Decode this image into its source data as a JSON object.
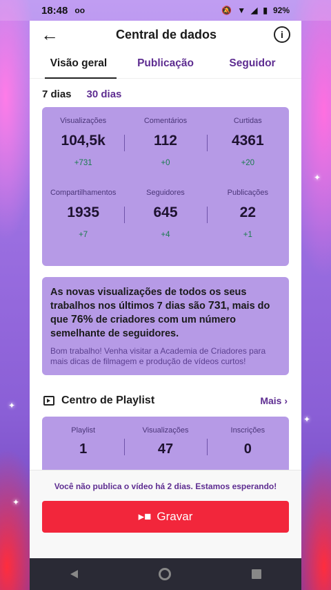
{
  "status": {
    "time": "18:48",
    "voicemail": "oo",
    "battery": "92%"
  },
  "header": {
    "title": "Central de dados"
  },
  "tabs": [
    {
      "label": "Visão geral"
    },
    {
      "label": "Publicação"
    },
    {
      "label": "Seguidor"
    }
  ],
  "period": {
    "selected": "7 dias",
    "other": "30 dias"
  },
  "stats": [
    [
      {
        "label": "Visualizações",
        "value": "104,5k",
        "delta": "+731"
      },
      {
        "label": "Comentários",
        "value": "112",
        "delta": "+0"
      },
      {
        "label": "Curtidas",
        "value": "4361",
        "delta": "+20"
      }
    ],
    [
      {
        "label": "Compartilhamentos",
        "value": "1935",
        "delta": "+7"
      },
      {
        "label": "Seguidores",
        "value": "645",
        "delta": "+4"
      },
      {
        "label": "Publicações",
        "value": "22",
        "delta": "+1"
      }
    ]
  ],
  "message": {
    "pre": "As novas visualizações de todos os seus trabalhos nos últimos 7 dias são ",
    "num1": "731",
    "mid": ", mais do que ",
    "num2": "76%",
    "post": " de criadores com um número semelhante de seguidores.",
    "sub": "Bom trabalho! Venha visitar a Academia de Criadores para mais dicas de filmagem e produção de vídeos curtos!"
  },
  "playlist": {
    "title": "Centro de Playlist",
    "more": "Mais",
    "stats": [
      {
        "label": "Playlist",
        "value": "1"
      },
      {
        "label": "Visualizações",
        "value": "47"
      },
      {
        "label": "Inscrições",
        "value": "0"
      }
    ]
  },
  "footer": {
    "note": "Você não publica o vídeo há 2 dias. Estamos esperando!",
    "record": "Gravar"
  }
}
